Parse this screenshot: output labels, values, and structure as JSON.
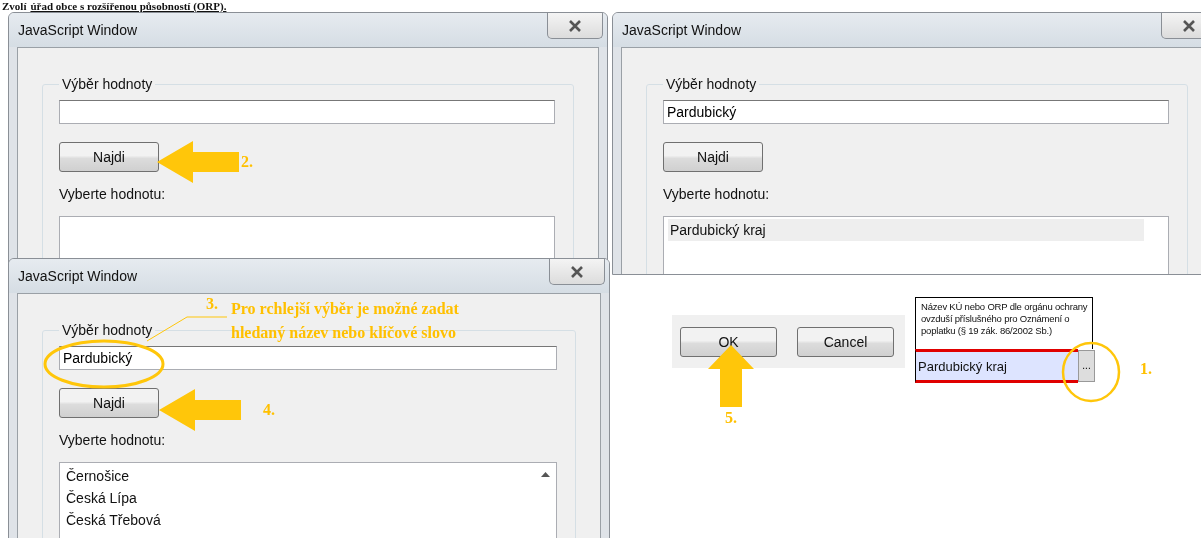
{
  "heading": {
    "prefix": "Zvolí",
    "link": "úřad obce s rozšířenou působností (ORP)."
  },
  "windows": [
    {
      "title": "JavaScript Window",
      "group_label": "Výběr hodnoty",
      "find_button": "Najdi",
      "list_label": "Vyberte hodnotu:",
      "find_note": {
        "number": "2."
      }
    },
    {
      "title": "JavaScript Window",
      "group_label": "Výběr hodnoty",
      "search_value": "Pardubický",
      "find_button": "Najdi",
      "list_label": "Vyberte hodnotu:",
      "list_items": [
        {
          "text": "Pardubický kraj",
          "selected": true
        }
      ]
    },
    {
      "title": "JavaScript Window",
      "group_label": "Výběr hodnoty",
      "search_value": "Pardubický",
      "find_button": "Najdi",
      "list_label": "Vyberte hodnotu:",
      "list_items": [
        {
          "text": "Černošice",
          "selected": false
        },
        {
          "text": "Česká Lípa",
          "selected": false
        },
        {
          "text": "Česká Třebová",
          "selected": false
        }
      ],
      "scrollbar": true,
      "field_note": {
        "number": "3.",
        "text": "Pro rchlejší výběr je možné zadat hledaný název nebo klíčové slovo"
      },
      "find_note": {
        "number": "4."
      }
    }
  ],
  "dialog_buttons": [
    {
      "label": "OK",
      "note": "5."
    },
    {
      "label": "Cancel"
    }
  ],
  "form_field": {
    "label": "Název KÚ nebo ORP dle orgánu ochrany ovzduší příslušného pro Oznámení o poplatku (§ 19 zák. 86/2002 Sb.)",
    "value": "Pardubický kraj",
    "button": "...",
    "note": "1."
  }
}
